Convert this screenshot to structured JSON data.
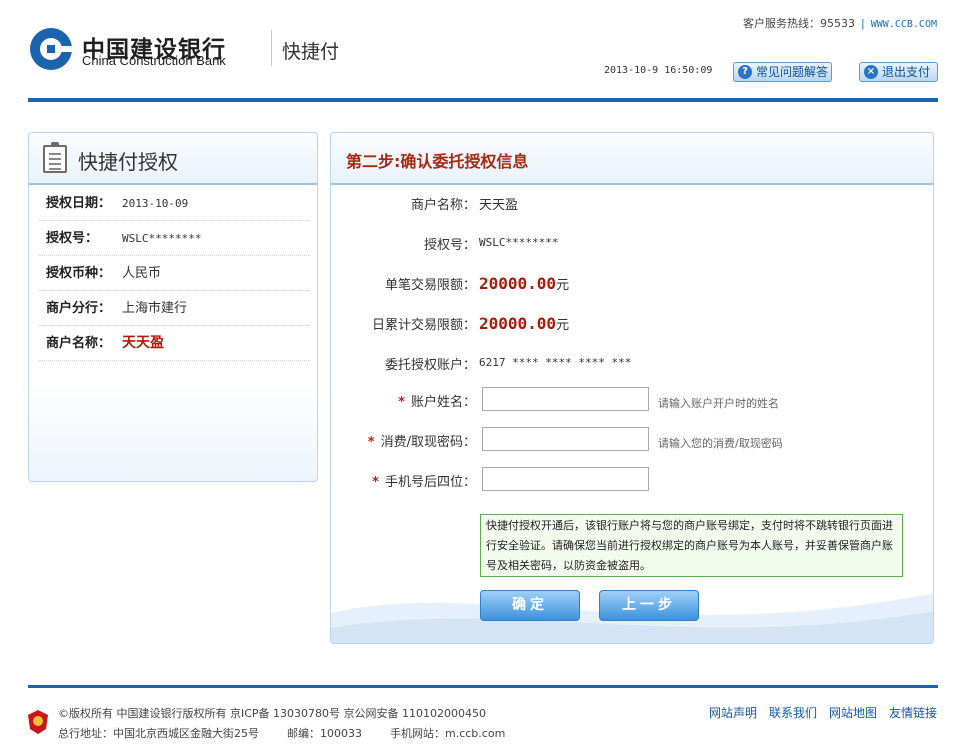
{
  "header": {
    "bank_name_cn": "中国建设银行",
    "bank_name_en": "China Construction Bank",
    "product_name": "快捷付",
    "hotline_label": "客户服务热线：95533",
    "site_url": "WWW.CCB.COM",
    "datetime": "2013-10-9 16:50:09",
    "faq_label": "常见问题解答",
    "exit_label": "退出支付",
    "icons": {
      "logo": "ccb-logo-icon",
      "faq": "question-icon",
      "exit": "close-icon"
    },
    "colors": {
      "brand_blue": "#1b63ad",
      "accent_red": "#b01a0b"
    }
  },
  "left_panel": {
    "title": "快捷付授权",
    "rows": [
      {
        "key": "授权日期：",
        "value": "2013-10-09"
      },
      {
        "key": "授权号：",
        "value": "WSLC********"
      },
      {
        "key": "授权币种：",
        "value": "人民币"
      },
      {
        "key": "商户分行：",
        "value": "上海市建行"
      },
      {
        "key": "商户名称：",
        "value": "天天盈"
      }
    ]
  },
  "right_panel": {
    "step_title": "第二步:确认委托授权信息",
    "merchant_name_label": "商户名称：",
    "merchant_name_value": "天天盈",
    "auth_no_label": "授权号：",
    "auth_no_value": "WSLC********",
    "single_limit_label": "单笔交易限额：",
    "single_limit_amount": "20000.00",
    "daily_limit_label": "日累计交易限额：",
    "daily_limit_amount": "20000.00",
    "currency_unit": "元",
    "account_label": "委托授权账户：",
    "account_value": "6217 **** **** **** ***",
    "required_mark": "*",
    "name_label": "账户姓名：",
    "name_value": "",
    "name_placeholder": "",
    "name_hint": "请输入账户开户时的姓名",
    "password_label": "消费/取现密码：",
    "password_value": "",
    "password_hint": "请输入您的消费/取现密码",
    "phone_label": "手机号后四位：",
    "phone_value": "",
    "notice": "快捷付授权开通后，该银行账户将与您的商户账号绑定，支付时将不跳转银行页面进行安全验证。请确保您当前进行授权绑定的商户账号为本人账号，并妥善保管商户账号及相关密码，以防资金被盗用。",
    "confirm_label": "确定",
    "prev_label": "上一步"
  },
  "footer": {
    "copyright": "©版权所有  中国建设银行版权所有  京ICP备 13030780号  京公网安备 110102000450",
    "address": "总行地址：中国北京西城区金融大街25号",
    "postcode": "邮编：100033",
    "mobile_site": "手机网站：m.ccb.com",
    "links": [
      "网站声明",
      "联系我们",
      "网站地图",
      "友情链接"
    ]
  }
}
